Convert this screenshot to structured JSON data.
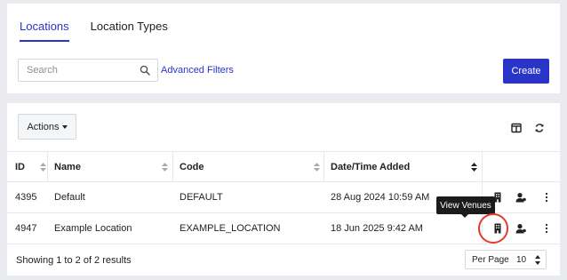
{
  "tabs": [
    {
      "label": "Locations",
      "active": true
    },
    {
      "label": "Location Types",
      "active": false
    }
  ],
  "search": {
    "placeholder": "Search",
    "value": ""
  },
  "advanced_filters_label": "Advanced Filters",
  "create_label": "Create",
  "actions_label": "Actions",
  "columns": [
    "ID",
    "Name",
    "Code",
    "Date/Time Added"
  ],
  "rows": [
    {
      "id": "4395",
      "name": "Default",
      "code": "DEFAULT",
      "added": "28 Aug 2024 10:59 AM"
    },
    {
      "id": "4947",
      "name": "Example Location",
      "code": "EXAMPLE_LOCATION",
      "added": "18 Jun 2025 9:42 AM"
    }
  ],
  "summary": "Showing 1 to 2 of 2 results",
  "per_page": {
    "label": "Per Page",
    "value": "10"
  },
  "tooltip": "View Venues",
  "colors": {
    "accent": "#2a35c8",
    "highlight_ring": "#e23b2e",
    "background": "#e9ebee"
  },
  "icons": [
    "search-icon",
    "columns-icon",
    "refresh-icon",
    "building-icon",
    "user-icon",
    "kebab-icon"
  ]
}
